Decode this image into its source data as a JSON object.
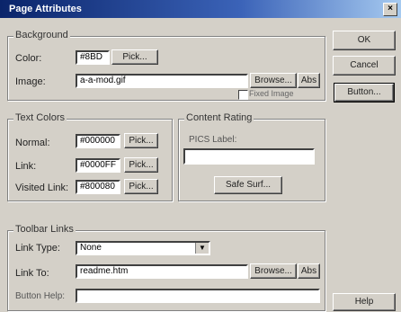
{
  "window": {
    "title": "Page Attributes",
    "close_glyph": "×"
  },
  "background": {
    "legend": "Background",
    "color_label": "Color:",
    "color_value": "#8BD",
    "color_pick": "Pick...",
    "image_label": "Image:",
    "image_value": "a-a-mod.gif",
    "browse": "Browse...",
    "abs": "Abs",
    "fixed_label": "Fixed Image"
  },
  "text_colors": {
    "legend": "Text Colors",
    "normal_label": "Normal:",
    "normal_value": "#000000",
    "link_label": "Link:",
    "link_value": "#0000FF",
    "visited_label": "Visited Link:",
    "visited_value": "#800080",
    "pick": "Pick..."
  },
  "content_rating": {
    "legend": "Content Rating",
    "pics_label": "PICS Label:",
    "pics_value": "",
    "safe_surf": "Safe Surf..."
  },
  "toolbar_links": {
    "legend": "Toolbar Links",
    "link_type_label": "Link Type:",
    "link_type_value": "None",
    "link_to_label": "Link To:",
    "link_to_value": "readme.htm",
    "browse": "Browse...",
    "abs": "Abs",
    "button_help_label": "Button Help:",
    "button_help_value": ""
  },
  "side_buttons": {
    "ok": "OK",
    "cancel": "Cancel",
    "button": "Button...",
    "help": "Help"
  },
  "icons": {
    "dropdown": "▼"
  }
}
